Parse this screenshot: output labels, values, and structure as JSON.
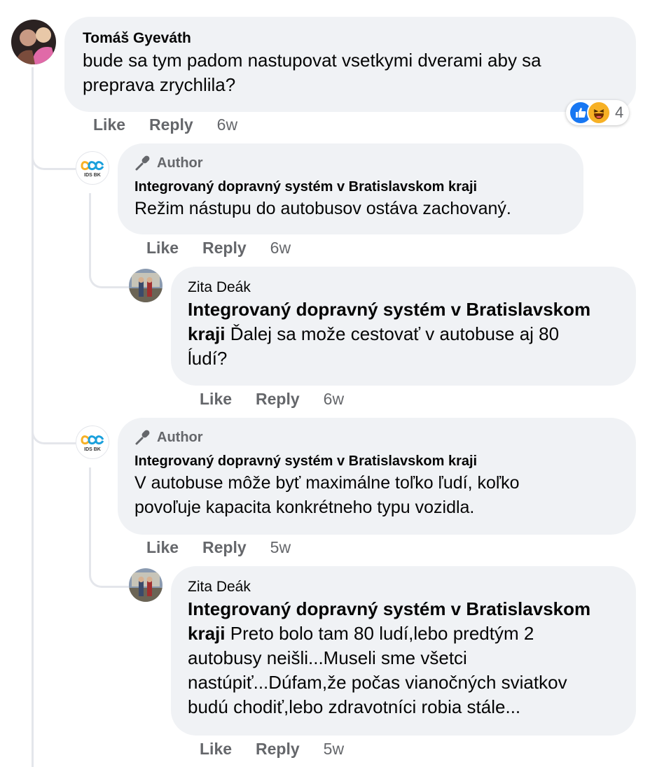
{
  "thread": {
    "top": {
      "author": "Tomáš Gyeváth",
      "text_line1": "bude sa tym padom nastupovat vsetkymi dverami aby sa",
      "text_line2": "preprava zrychlila?",
      "reaction_count": "4",
      "reaction_icons": [
        "like-icon",
        "haha-icon"
      ],
      "actions": {
        "like": "Like",
        "reply": "Reply",
        "time": "6w"
      }
    },
    "reply1": {
      "badge": "Author",
      "author": "Integrovaný dopravný systém v Bratislavskom kraji",
      "text": "Režim nástupu do autobusov ostáva zachovaný.",
      "avatar_label": "IDS BK",
      "actions": {
        "like": "Like",
        "reply": "Reply",
        "time": "6w"
      }
    },
    "reply1_1": {
      "author": "Zita Deák",
      "mention_line1": "Integrovaný dopravný systém v Bratislavskom",
      "mention_line2": "kraji",
      "text_rest_line2": "Ďalej sa može cestovať v autobuse aj 80",
      "text_line3": "ĺudí?",
      "actions": {
        "like": "Like",
        "reply": "Reply",
        "time": "6w"
      }
    },
    "reply2": {
      "badge": "Author",
      "author": "Integrovaný dopravný systém v Bratislavskom kraji",
      "text_line1": "V autobuse môže byť maximálne toľko ľudí, koľko",
      "text_line2": "povoľuje kapacita konkrétneho typu vozidla.",
      "avatar_label": "IDS BK",
      "actions": {
        "like": "Like",
        "reply": "Reply",
        "time": "5w"
      }
    },
    "reply2_1": {
      "author": "Zita Deák",
      "mention_line1": "Integrovaný dopravný systém v Bratislavskom",
      "mention_line2": "kraji",
      "text_rest_line2": "Preto bolo tam 80 ludí,lebo predtým 2",
      "text_line3": "autobusy neišli...Museli sme všetci",
      "text_line4": "nastúpiť...Dúfam,že počas vianočných sviatkov",
      "text_line5": "budú chodiť,lebo zdravotníci robia stále...",
      "actions": {
        "like": "Like",
        "reply": "Reply",
        "time": "5w"
      }
    }
  },
  "colors": {
    "bubble": "#f0f2f5",
    "meta": "#65676b",
    "like_blue": "#1877f2",
    "haha_yellow": "#f7b125"
  }
}
